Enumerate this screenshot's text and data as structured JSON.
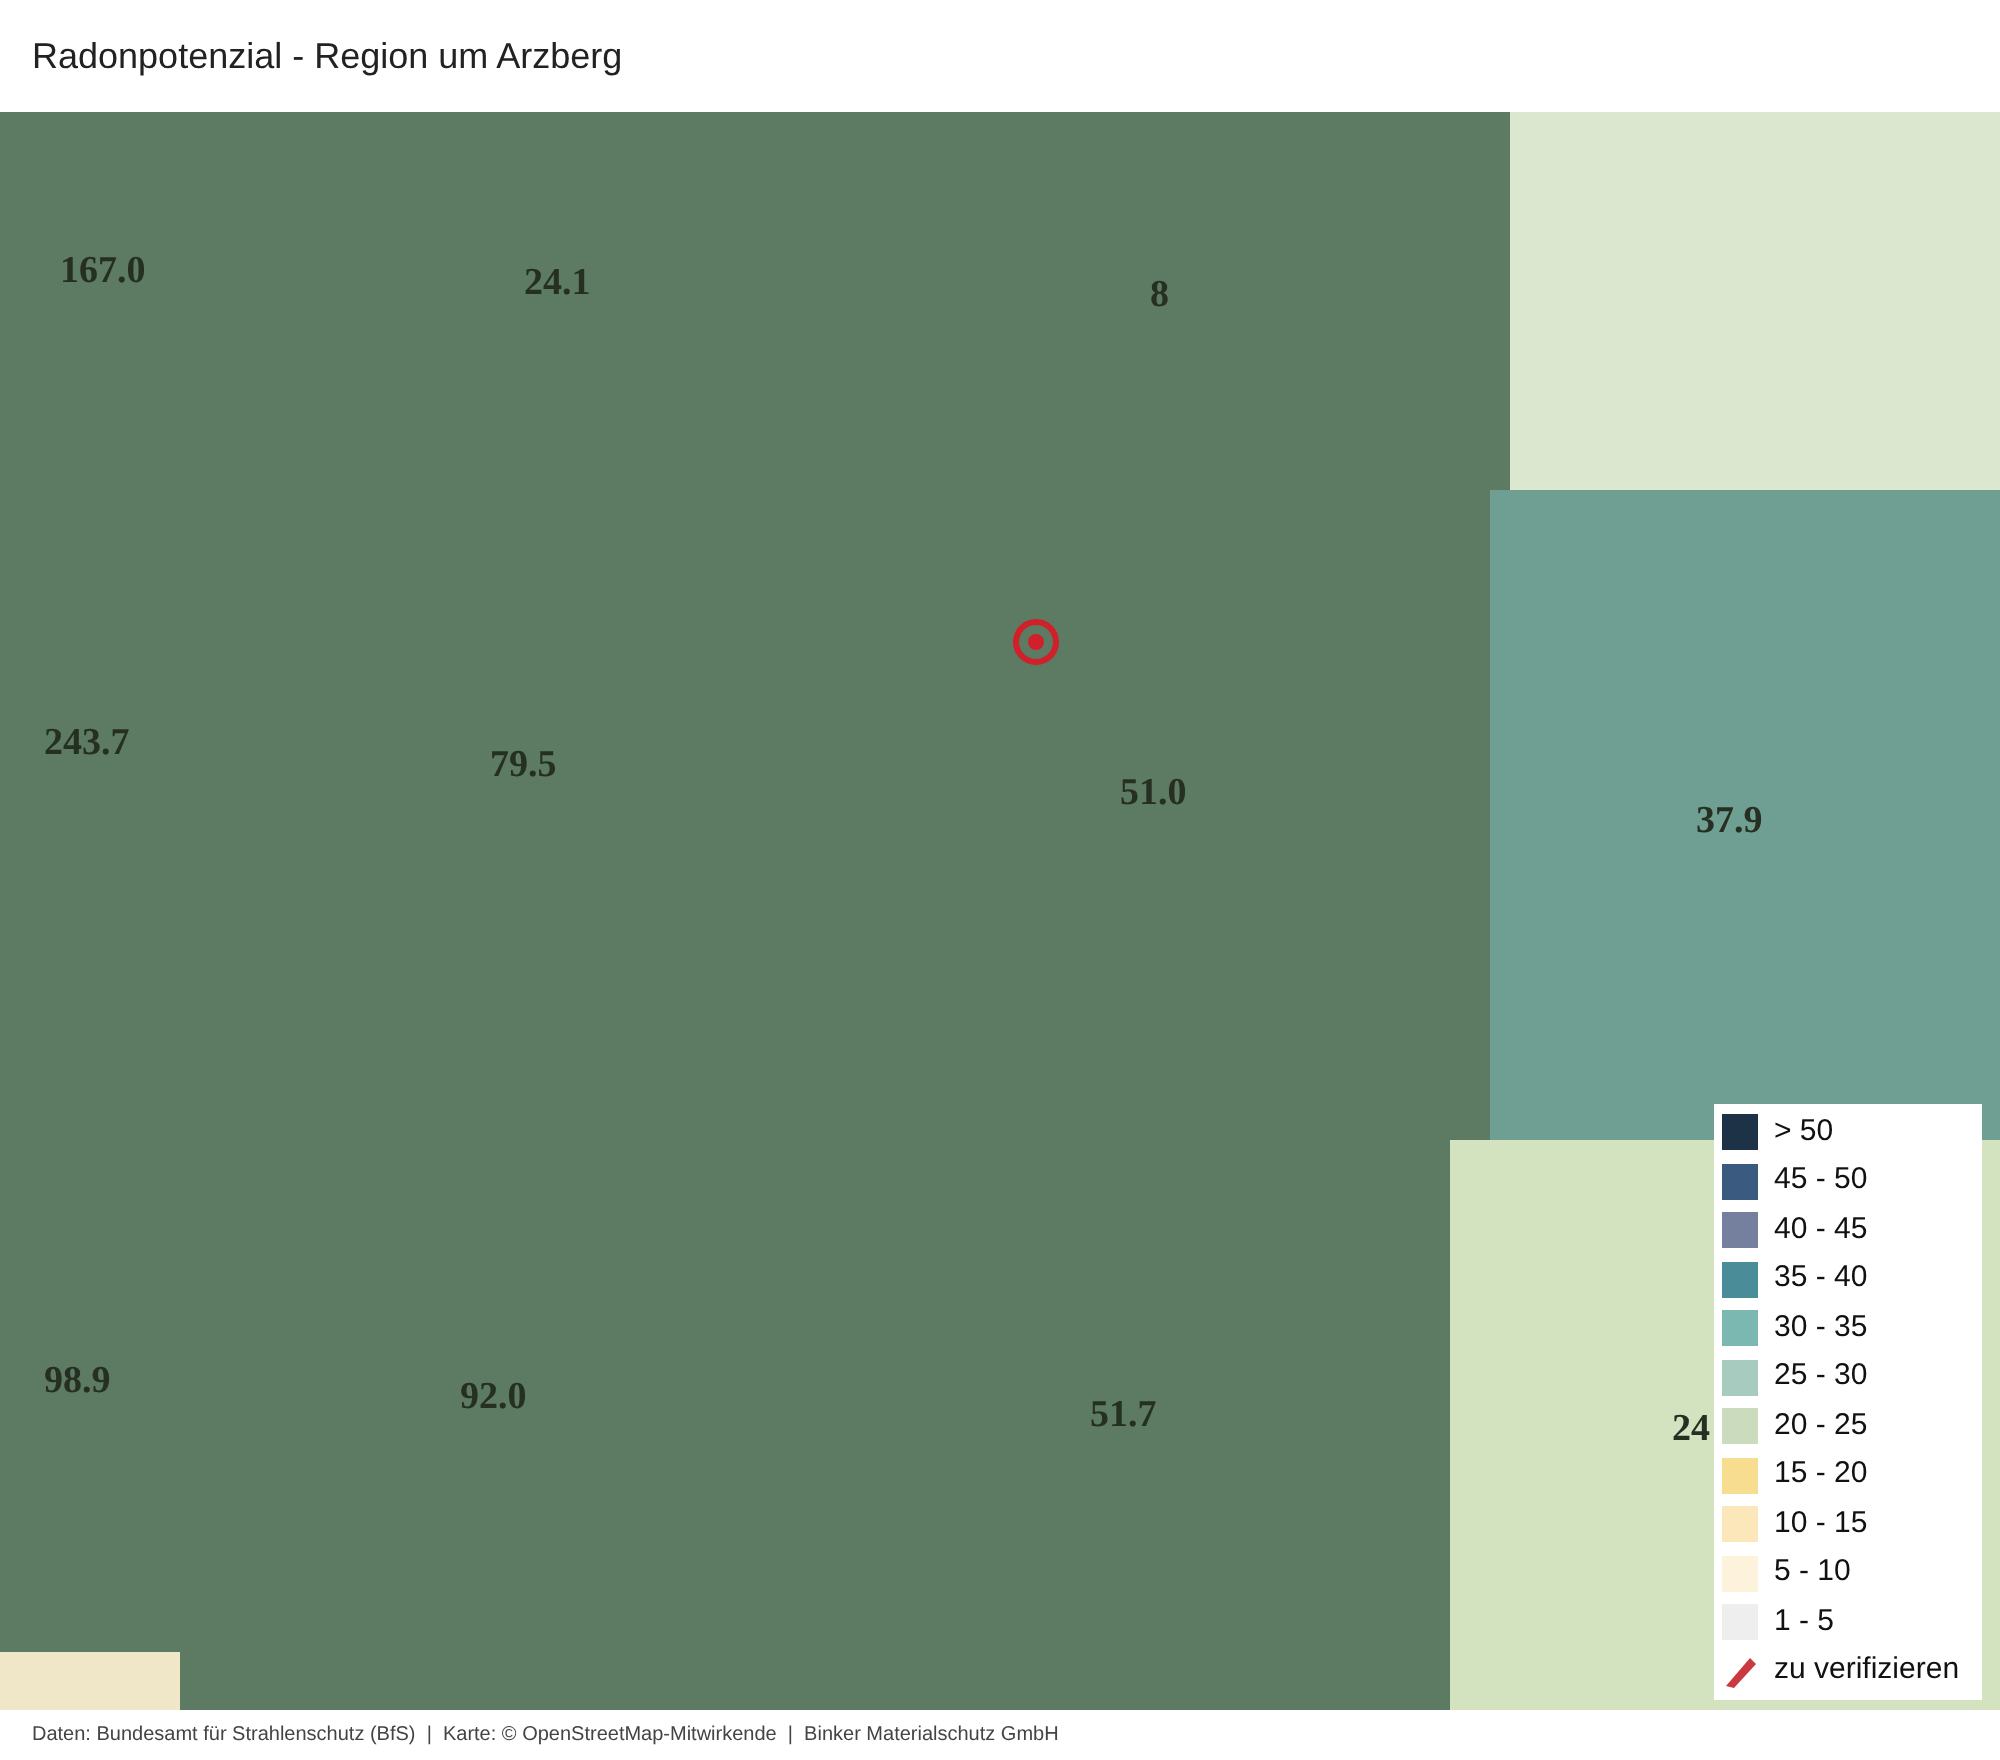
{
  "title": "Radonpotenzial - Region um Arzberg",
  "map": {
    "values": [
      "167.0",
      "24.1",
      "8",
      "243.7",
      "79.5",
      "51.0",
      "37.9",
      "98.9",
      "92.0",
      "51.7",
      "24"
    ]
  },
  "legend": [
    {
      "label": "> 50",
      "color": "#1e3247",
      "kind": "swatch"
    },
    {
      "label": "45 - 50",
      "color": "#3a5a80",
      "kind": "swatch"
    },
    {
      "label": "40 - 45",
      "color": "#757f9e",
      "kind": "swatch"
    },
    {
      "label": "35 - 40",
      "color": "#4a8d99",
      "kind": "swatch"
    },
    {
      "label": "30 - 35",
      "color": "#7cb8b2",
      "kind": "swatch"
    },
    {
      "label": "25 - 30",
      "color": "#a8cbbf",
      "kind": "swatch"
    },
    {
      "label": "20 - 25",
      "color": "#cbdbbd",
      "kind": "swatch"
    },
    {
      "label": "15 - 20",
      "color": "#f7dd8f",
      "kind": "swatch"
    },
    {
      "label": "10 - 15",
      "color": "#fbe7b9",
      "kind": "swatch"
    },
    {
      "label": "5 - 10",
      "color": "#fdf3dc",
      "kind": "swatch"
    },
    {
      "label": "1 - 5",
      "color": "#eeeeee",
      "kind": "swatch"
    },
    {
      "label": "zu verifizieren",
      "color": "#c9393f",
      "kind": "hatch"
    }
  ],
  "footer": "Daten: Bundesamt für Strahlenschutz (BfS)  |  Karte: © OpenStreetMap-Mitwirkende  |  Binker Materialschutz GmbH"
}
